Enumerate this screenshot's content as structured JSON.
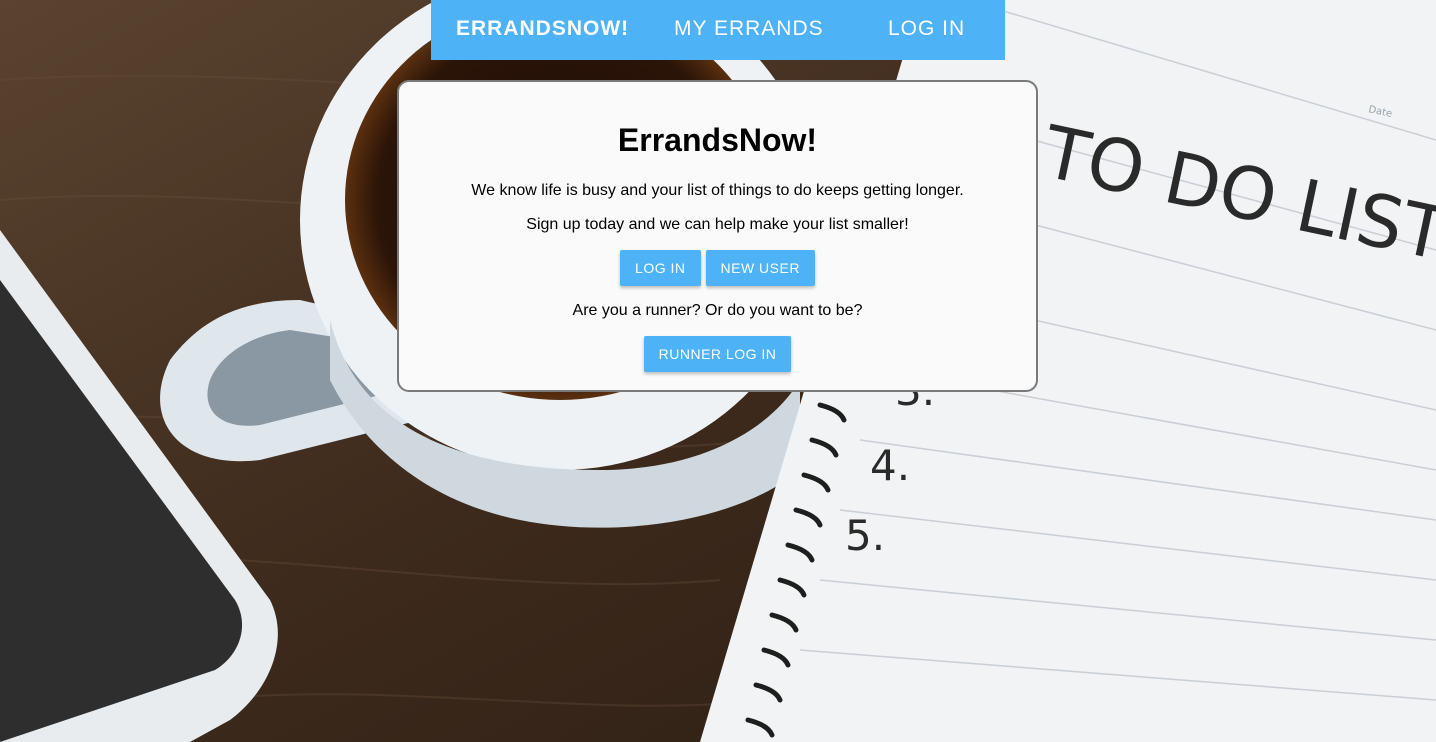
{
  "nav": {
    "brand": "ERRANDSNOW!",
    "my_errands": "MY ERRANDS",
    "log_in": "LOG IN"
  },
  "card": {
    "title": "ErrandsNow!",
    "line1": "We know life is busy and your list of things to do keeps getting longer.",
    "line2": "Sign up today and we can help make your list smaller!",
    "login_button": "LOG IN",
    "new_user_button": "NEW USER",
    "runner_question": "Are you a runner? Or do you want to be?",
    "runner_login_button": "RUNNER LOG IN"
  },
  "background": {
    "notebook_heading": "TO DO LIST",
    "notebook_items": [
      "3.",
      "4.",
      "5."
    ],
    "notebook_date_label": "Date"
  },
  "colors": {
    "accent": "#4db2f6",
    "card_bg": "#fafafa"
  }
}
